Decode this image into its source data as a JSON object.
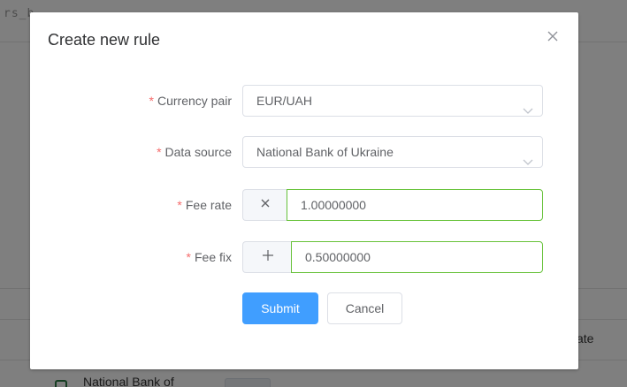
{
  "background": {
    "top_text": "rs_b",
    "right_text": "ate",
    "bottom_text": "National Bank of"
  },
  "dialog": {
    "title": "Create new rule",
    "close_icon": "close-icon",
    "fields": {
      "currency_pair": {
        "label": "Currency pair",
        "required_mark": "*",
        "value": "EUR/UAH"
      },
      "data_source": {
        "label": "Data source",
        "required_mark": "*",
        "value": "National Bank of Ukraine"
      },
      "fee_rate": {
        "label": "Fee rate",
        "required_mark": "*",
        "value": "1.00000000",
        "operator_icon": "times-icon"
      },
      "fee_fix": {
        "label": "Fee fix",
        "required_mark": "*",
        "value": "0.50000000",
        "operator_icon": "plus-icon"
      }
    },
    "buttons": {
      "submit": "Submit",
      "cancel": "Cancel"
    }
  },
  "colors": {
    "primary": "#409eff",
    "valid_border": "#67c23a",
    "required": "#f56c6c"
  }
}
